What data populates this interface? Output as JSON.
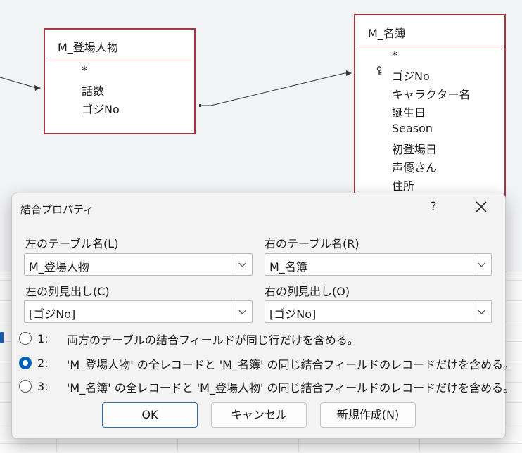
{
  "tables": {
    "left": {
      "title": "M_登場人物",
      "fields": [
        "*",
        "話数",
        "ゴジNo"
      ]
    },
    "right": {
      "title": "M_名簿",
      "fields": [
        "*",
        "ゴジNo",
        "キャラクター名",
        "誕生日",
        "Season",
        "初登場日",
        "声優さん",
        "住所"
      ],
      "key_field_index": 1
    }
  },
  "dialog": {
    "title": "結合プロパティ",
    "help_label": "?",
    "close_icon": "close-icon",
    "left_table_label": "左のテーブル名(L)",
    "left_table_value": "M_登場人物",
    "right_table_label": "右のテーブル名(R)",
    "right_table_value": "M_名簿",
    "left_column_label": "左の列見出し(C)",
    "left_column_value": "[ゴジNo]",
    "right_column_label": "右の列見出し(O)",
    "right_column_value": "[ゴジNo]",
    "options": [
      {
        "num": "1:",
        "text": "両方のテーブルの結合フィールドが同じ行だけを含める。",
        "selected": false
      },
      {
        "num": "2:",
        "text": "'M_登場人物' の全レコードと 'M_名簿' の同じ結合フィールドのレコードだけを含める。",
        "selected": true
      },
      {
        "num": "3:",
        "text": "'M_名簿' の全レコードと 'M_登場人物' の同じ結合フィールドのレコードだけを含める。",
        "selected": false
      }
    ],
    "buttons": {
      "ok": "OK",
      "cancel": "キャンセル",
      "new": "新規作成(N)"
    }
  },
  "colors": {
    "table_border": "#a3363f",
    "accent": "#005fb8"
  }
}
